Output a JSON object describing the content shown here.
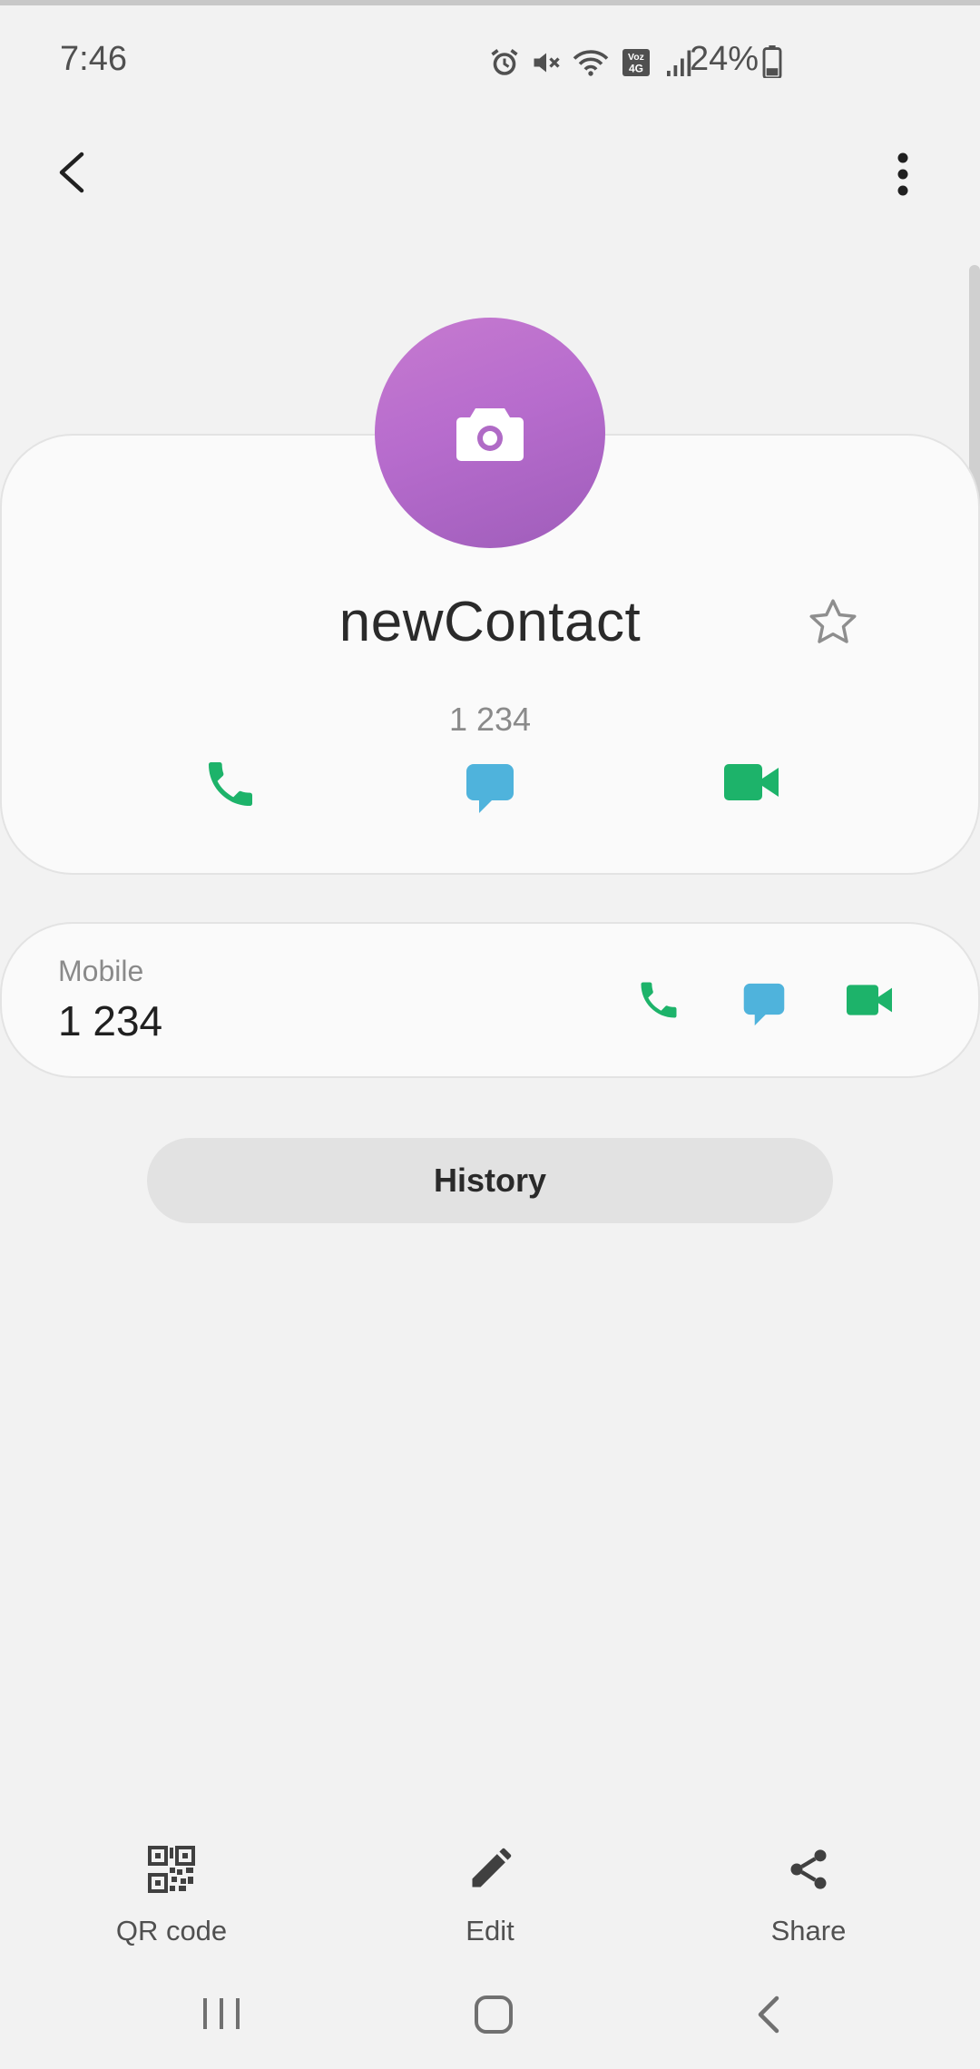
{
  "status_bar": {
    "time": "7:46",
    "network_label": "Voz 4G",
    "battery": "24%"
  },
  "contact": {
    "name": "newContact",
    "number": "1 234",
    "avatar_color": "#b86bcb"
  },
  "phone_entry": {
    "label": "Mobile",
    "value": "1 234"
  },
  "history": {
    "label": "History"
  },
  "actions": {
    "qr_label": "QR code",
    "edit_label": "Edit",
    "share_label": "Share"
  },
  "colors": {
    "call_green": "#1db36a",
    "message_blue": "#4fb3dc",
    "video_green": "#1db36a"
  },
  "icons": [
    "alarm-icon",
    "mute-icon",
    "wifi-icon",
    "volte-icon",
    "signal-icon",
    "battery-icon",
    "back-icon",
    "more-icon",
    "camera-icon",
    "star-icon",
    "call-icon",
    "message-icon",
    "video-icon",
    "qr-icon",
    "edit-icon",
    "share-icon",
    "nav-recents-icon",
    "nav-home-icon",
    "nav-back-icon"
  ]
}
